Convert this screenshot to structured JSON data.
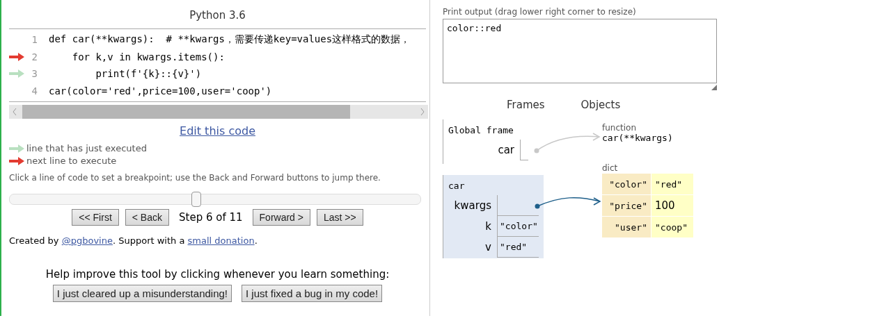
{
  "editor": {
    "title": "Python 3.6",
    "lines": [
      {
        "number": "1",
        "text": "def car(**kwargs):  # **kwargs，需要传递key=values这样格式的数据，",
        "kind": "plain"
      },
      {
        "number": "2",
        "text": "    for k,v in kwargs.items():",
        "kind": "next"
      },
      {
        "number": "3",
        "text": "        print(f'{k}::{v}')",
        "kind": "executed"
      },
      {
        "number": "4",
        "text": "car(color='red',price=100,user='coop')",
        "kind": "plain"
      }
    ]
  },
  "edit_link": "Edit this code",
  "legend": [
    {
      "kind": "executed",
      "text": "line that has just executed"
    },
    {
      "kind": "next",
      "text": "next line to execute"
    }
  ],
  "hint": "Click a line of code to set a breakpoint; use the Back and Forward buttons to jump there.",
  "slider": {
    "level": 0.455
  },
  "nav": [
    {
      "kind": "button",
      "label": "<< First"
    },
    {
      "kind": "button",
      "label": "< Back"
    },
    {
      "kind": "label",
      "label": "Step 6 of 11"
    },
    {
      "kind": "button",
      "label": "Forward >"
    },
    {
      "kind": "button",
      "label": "Last >>"
    }
  ],
  "credits": [
    {
      "kind": "text",
      "text": "Created by "
    },
    {
      "kind": "link",
      "text": "@pgbovine"
    },
    {
      "kind": "text",
      "text": ". Support with a "
    },
    {
      "kind": "link",
      "text": "small donation"
    },
    {
      "kind": "text",
      "text": "."
    }
  ],
  "feedback": {
    "prompt": "Help improve this tool by clicking whenever you learn something:",
    "buttons": [
      "I just cleared up a misunderstanding!",
      "I just fixed a bug in my code!"
    ]
  },
  "output": {
    "label": "Print output (drag lower right corner to resize)",
    "value": "color::red"
  },
  "visualizer": {
    "frames_heading": "Frames",
    "objects_heading": "Objects",
    "frames": [
      {
        "title": "Global frame",
        "active": false,
        "vars": [
          {
            "name": "car",
            "kind": "pointer"
          }
        ]
      },
      {
        "title": "car",
        "active": true,
        "vars": [
          {
            "name": "kwargs",
            "kind": "pointer"
          },
          {
            "name": "k",
            "kind": "value",
            "value": "\"color\""
          },
          {
            "name": "v",
            "kind": "value",
            "value": "\"red\""
          }
        ]
      }
    ],
    "objects": [
      {
        "kind": "function",
        "label": "function",
        "value": "car(**kwargs)"
      },
      {
        "kind": "dict",
        "label": "dict",
        "entries": [
          {
            "key": "\"color\"",
            "value": "\"red\"",
            "kind": "string"
          },
          {
            "key": "\"price\"",
            "value": "100",
            "kind": "number"
          },
          {
            "key": "\"user\"",
            "value": "\"coop\"",
            "kind": "string"
          }
        ]
      }
    ]
  }
}
